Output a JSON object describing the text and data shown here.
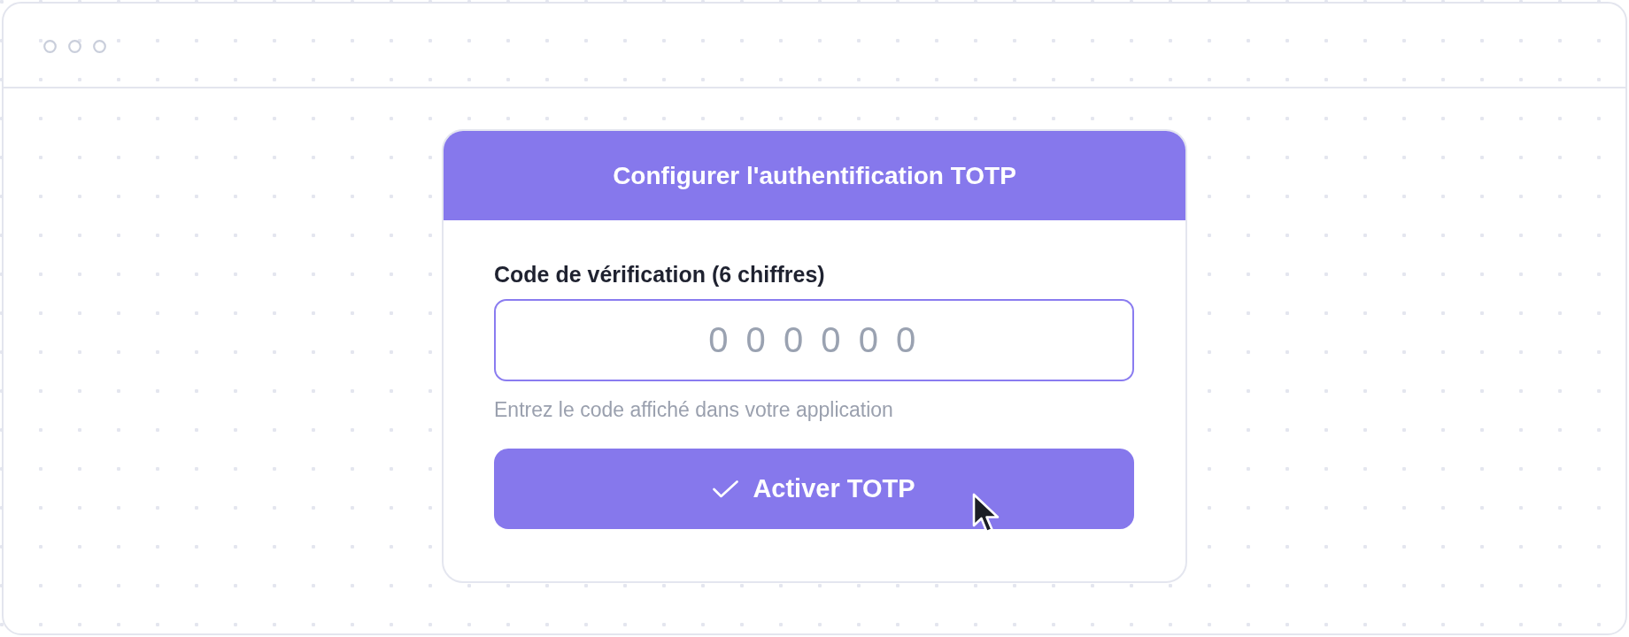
{
  "dialog": {
    "title": "Configurer l'authentification TOTP"
  },
  "form": {
    "field": {
      "label": "Code de vérification (6 chiffres)",
      "placeholder": "0 0 0 0 0 0",
      "focused": true,
      "hint": "Entrez le code affiché dans votre application"
    },
    "submit_button": {
      "label": "Activer TOTP"
    }
  }
}
